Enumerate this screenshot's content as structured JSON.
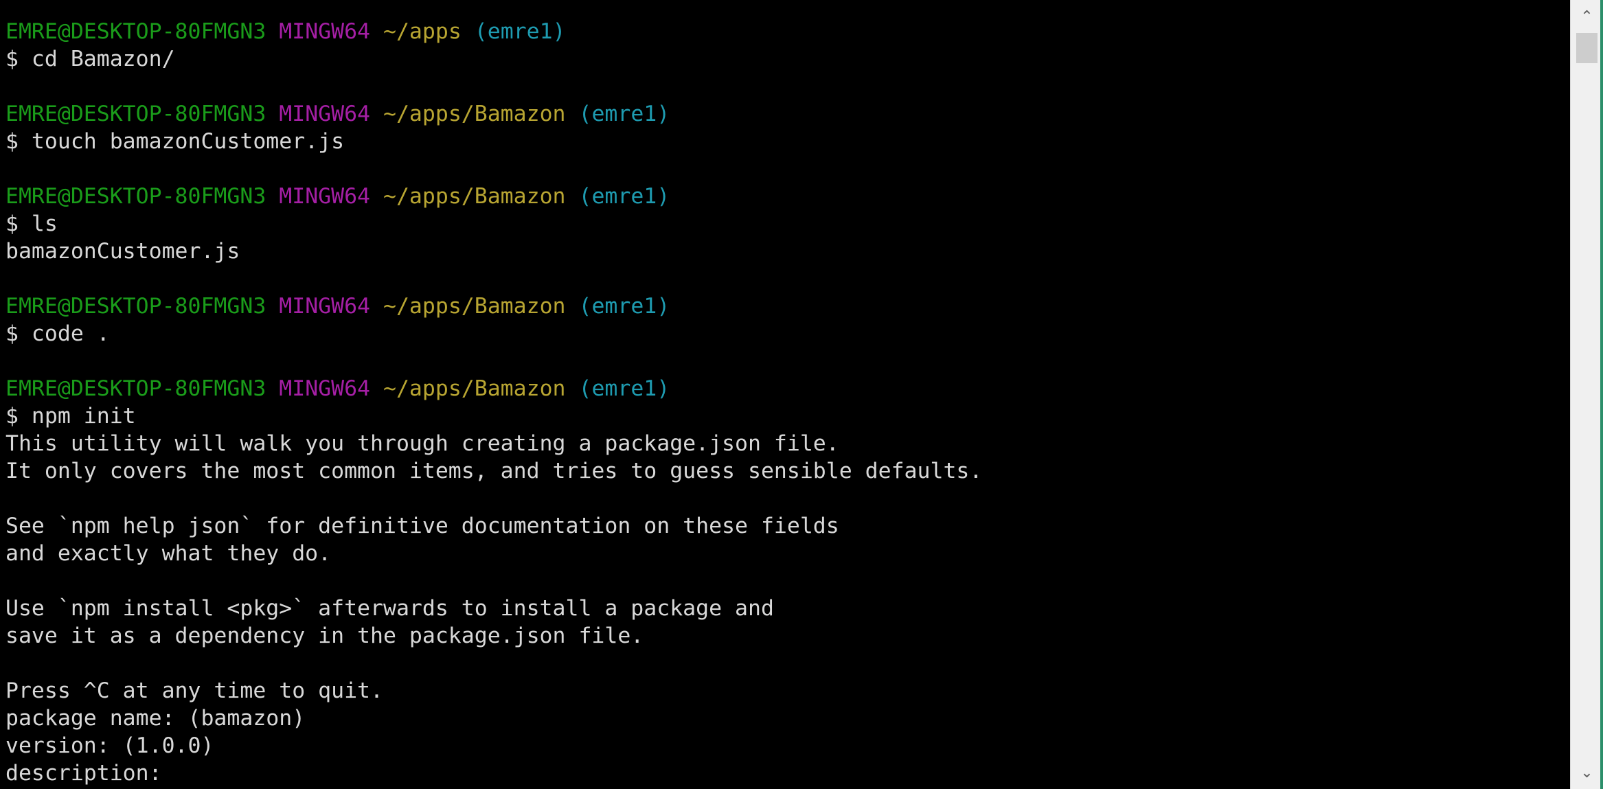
{
  "colors": {
    "background": "#000000",
    "text": "#d8d8d8",
    "user_host": "#1a9c1a",
    "system": "#a51fa5",
    "path": "#b8a532",
    "branch": "#1e9bb0"
  },
  "terminal": {
    "prompts": [
      {
        "user": "EMRE@DESKTOP-80FMGN3",
        "system": "MINGW64",
        "path": "~/apps",
        "branch": "(emre1)",
        "command": "$ cd Bamazon/"
      },
      {
        "user": "EMRE@DESKTOP-80FMGN3",
        "system": "MINGW64",
        "path": "~/apps/Bamazon",
        "branch": "(emre1)",
        "command": "$ touch bamazonCustomer.js"
      },
      {
        "user": "EMRE@DESKTOP-80FMGN3",
        "system": "MINGW64",
        "path": "~/apps/Bamazon",
        "branch": "(emre1)",
        "command": "$ ls"
      },
      {
        "user": "EMRE@DESKTOP-80FMGN3",
        "system": "MINGW64",
        "path": "~/apps/Bamazon",
        "branch": "(emre1)",
        "command": "$ code ."
      },
      {
        "user": "EMRE@DESKTOP-80FMGN3",
        "system": "MINGW64",
        "path": "~/apps/Bamazon",
        "branch": "(emre1)",
        "command": "$ npm init"
      }
    ],
    "ls_output": "bamazonCustomer.js",
    "npm_output": [
      "This utility will walk you through creating a package.json file.",
      "It only covers the most common items, and tries to guess sensible defaults.",
      "See `npm help json` for definitive documentation on these fields",
      "and exactly what they do.",
      "Use `npm install <pkg>` afterwards to install a package and",
      "save it as a dependency in the package.json file.",
      "Press ^C at any time to quit.",
      "package name: (bamazon)",
      "version: (1.0.0)",
      "description:"
    ]
  },
  "scrollbar": {
    "up_icon": "chevron-up-icon",
    "down_icon": "chevron-down-icon"
  }
}
